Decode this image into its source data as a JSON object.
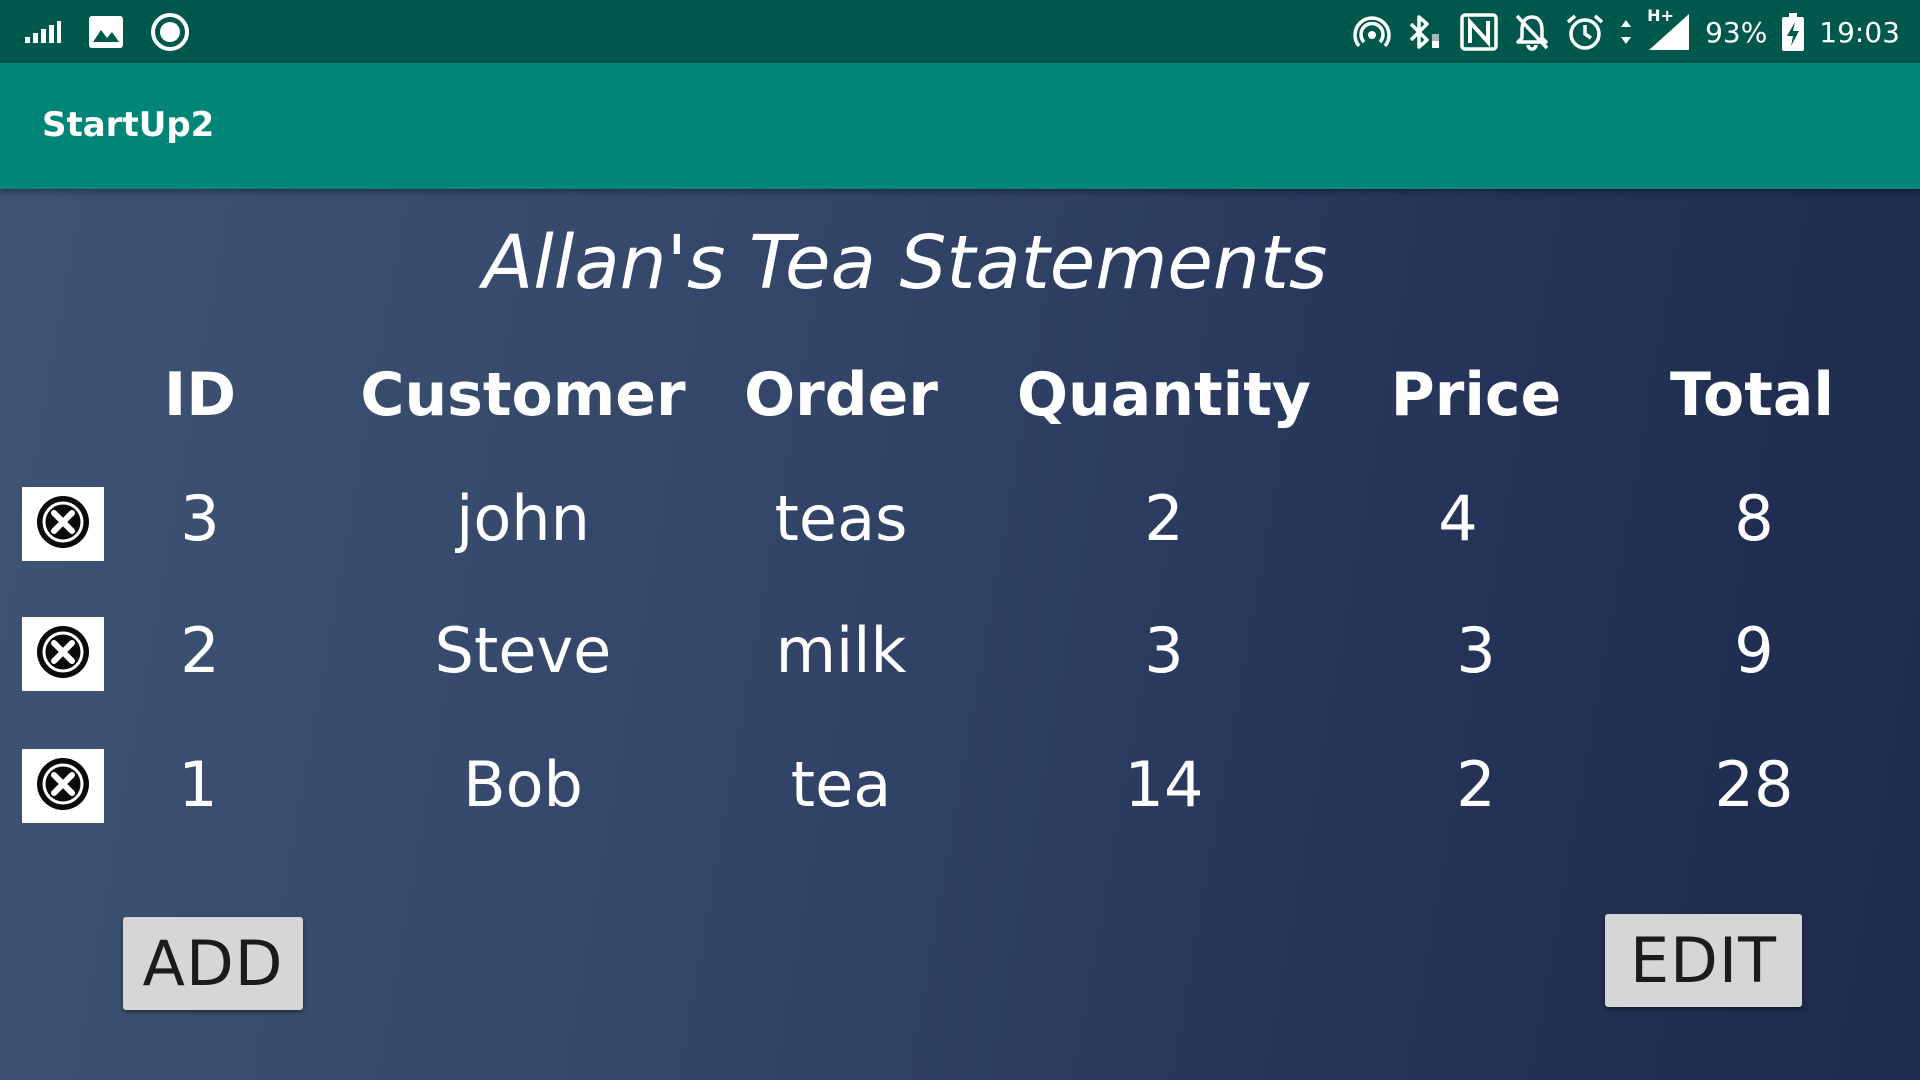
{
  "status_bar": {
    "battery": "93%",
    "time": "19:03",
    "network_label": "H+",
    "left_icons": [
      "signal-bars-icon",
      "image-icon",
      "circle-record-icon"
    ],
    "right_icons": [
      "hotspot-icon",
      "bluetooth-icon",
      "nfc-icon",
      "bell-off-icon",
      "alarm-icon",
      "data-arrows-icon",
      "cell-signal-icon",
      "battery-charging-icon"
    ]
  },
  "app_bar": {
    "title": "StartUp2",
    "color": "#008577"
  },
  "page": {
    "title": "Allan's Tea Statements"
  },
  "table": {
    "headers": {
      "id": "ID",
      "customer": "Customer",
      "order": "Order",
      "quantity": "Quantity",
      "price": "Price",
      "total": "Total"
    },
    "rows": [
      {
        "id": "3",
        "customer": "john",
        "order": "teas",
        "quantity": "2",
        "price": "4",
        "total": "8"
      },
      {
        "id": "2",
        "customer": "Steve",
        "order": "milk",
        "quantity": "3",
        "price": "3",
        "total": "9"
      },
      {
        "id": "1",
        "customer": "Bob",
        "order": "tea",
        "quantity": "14",
        "price": "2",
        "total": "28"
      }
    ],
    "delete_icon": "close-circle-icon"
  },
  "buttons": {
    "add_label": "ADD",
    "edit_label": "EDIT"
  }
}
